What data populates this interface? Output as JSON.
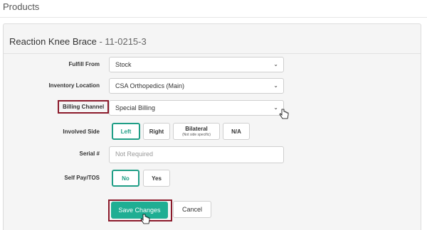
{
  "page": {
    "title": "Products"
  },
  "panel": {
    "product_name": "Reaction Knee Brace",
    "separator": " - ",
    "sku": "11-0215-3"
  },
  "form": {
    "fulfill_from": {
      "label": "Fulfill From",
      "value": "Stock"
    },
    "inventory_location": {
      "label": "Inventory Location",
      "value": "CSA Orthopedics (Main)"
    },
    "billing_channel": {
      "label": "Billing Channel",
      "value": "Special Billing"
    },
    "involved_side": {
      "label": "Involved Side",
      "options": [
        {
          "label": "Left",
          "sub": ""
        },
        {
          "label": "Right",
          "sub": ""
        },
        {
          "label": "Bilateral",
          "sub": "(Not side specific)"
        },
        {
          "label": "N/A",
          "sub": ""
        }
      ],
      "selected": "Left"
    },
    "serial": {
      "label": "Serial #",
      "placeholder": "Not Required"
    },
    "self_pay": {
      "label": "Self Pay/TOS",
      "options": [
        "No",
        "Yes"
      ],
      "selected": "No"
    }
  },
  "actions": {
    "save": "Save Changes",
    "cancel": "Cancel"
  },
  "colors": {
    "accent": "#1fae93",
    "highlight": "#8b1a2b"
  }
}
